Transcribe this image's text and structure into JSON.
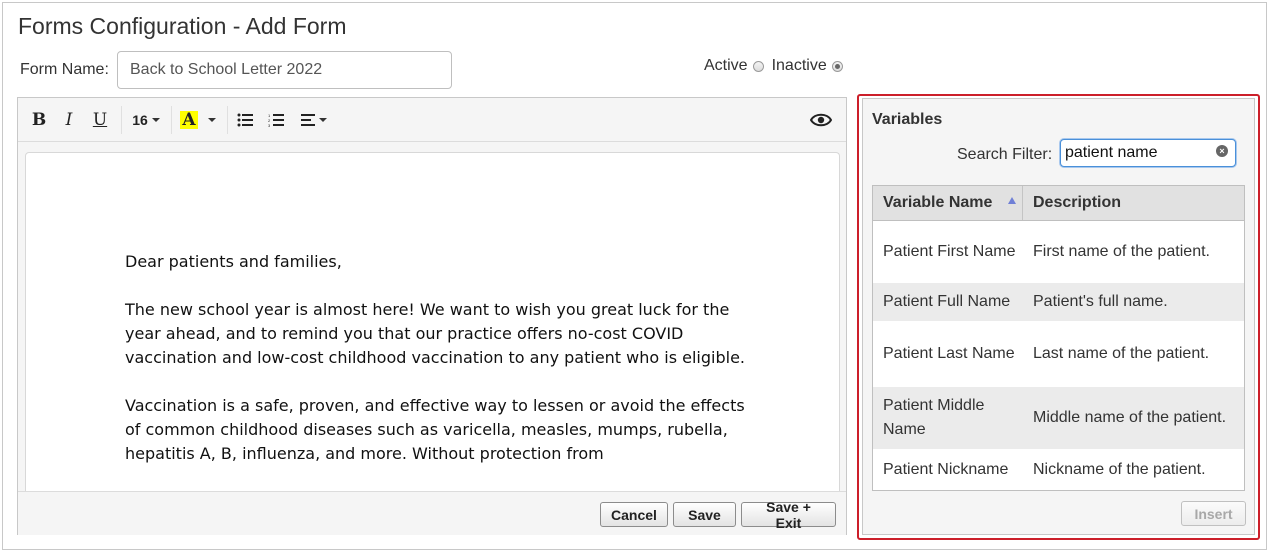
{
  "header": {
    "title": "Forms Configuration - Add Form"
  },
  "form": {
    "name_label": "Form Name:",
    "name_value": "Back to School Letter 2022",
    "status": {
      "active_label": "Active",
      "inactive_label": "Inactive",
      "selected": "Inactive"
    }
  },
  "toolbar": {
    "bold": "B",
    "italic": "I",
    "underline": "U",
    "font_size": "16",
    "highlight": "A"
  },
  "letter": {
    "paragraphs": [
      "Dear patients and families,",
      "The new school year is almost here! We want to wish you great luck for the year ahead, and to remind you that our practice offers no-cost COVID vaccination and low-cost childhood vaccination to any patient who is eligible.",
      "Vaccination is a safe, proven, and effective way to lessen or avoid the effects of common childhood diseases such as varicella, measles, mumps, rubella, hepatitis A, B, influenza, and more. Without protection from"
    ]
  },
  "footer": {
    "cancel_label": "Cancel",
    "save_label": "Save",
    "save_exit_label": "Save + Exit"
  },
  "variables": {
    "title": "Variables",
    "search_label": "Search Filter:",
    "search_value": "patient name",
    "columns": [
      "Variable Name",
      "Description"
    ],
    "rows": [
      {
        "name": "Patient First Name",
        "description": "First name of the patient."
      },
      {
        "name": "Patient Full Name",
        "description": "Patient's full name."
      },
      {
        "name": "Patient Last Name",
        "description": "Last name of the patient."
      },
      {
        "name": "Patient Middle Name",
        "description": "Middle name of the patient."
      },
      {
        "name": "Patient Nickname",
        "description": "Nickname of the patient."
      }
    ],
    "insert_label": "Insert"
  },
  "colors": {
    "highlight_border": "#cc1f2a",
    "sort_arrow": "#6f7fd6",
    "text_highlight": "#ffff00"
  }
}
